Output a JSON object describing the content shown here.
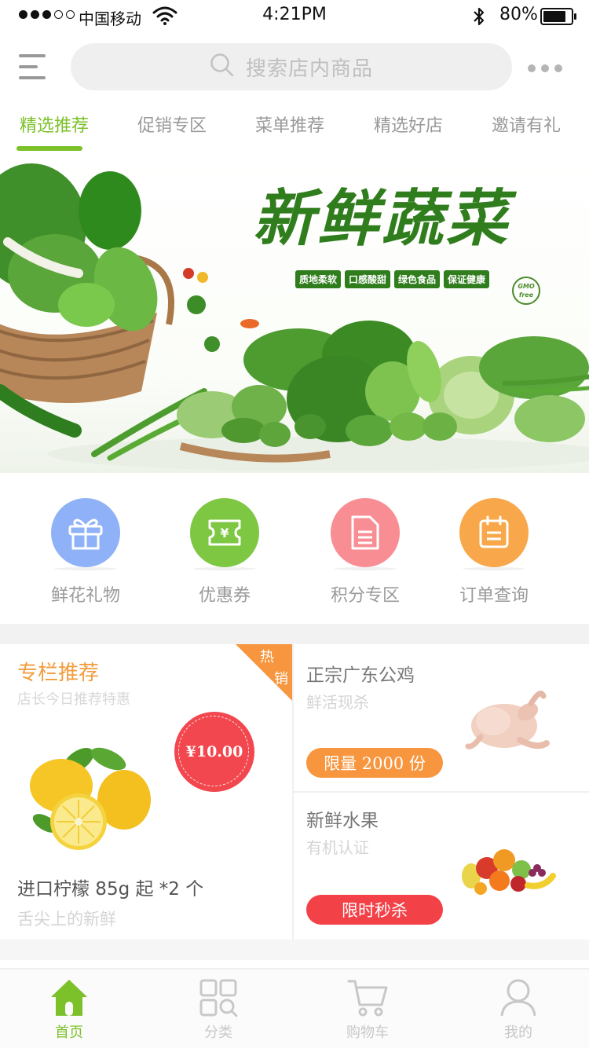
{
  "status_bar": {
    "carrier": "中国移动",
    "time": "4:21PM",
    "battery": "80%"
  },
  "header": {
    "menu_icon": "hamburger-icon",
    "search_placeholder": "搜索店内商品",
    "search_icon": "search-icon",
    "more_icon": "ellipsis-icon"
  },
  "tabs": [
    {
      "label": "精选推荐",
      "active": true
    },
    {
      "label": "促销专区",
      "active": false
    },
    {
      "label": "菜单推荐",
      "active": false
    },
    {
      "label": "精选好店",
      "active": false
    },
    {
      "label": "邀请有礼",
      "active": false
    }
  ],
  "banner": {
    "title": "新鲜蔬菜",
    "tags": [
      "质地柔软",
      "口感酸甜",
      "绿色食品",
      "保证健康"
    ],
    "logo_text": "GMO free"
  },
  "quick_entries": [
    {
      "label": "鲜花礼物",
      "icon": "gift-icon",
      "color": "#8fb1f7"
    },
    {
      "label": "优惠券",
      "icon": "coupon-icon",
      "color": "#7dc743"
    },
    {
      "label": "积分专区",
      "icon": "document-icon",
      "color": "#f88e94"
    },
    {
      "label": "订单查询",
      "icon": "calendar-icon",
      "color": "#f8a84a"
    }
  ],
  "featured": {
    "title": "专栏推荐",
    "subtitle": "店长今日推荐特惠",
    "hot_tag": [
      "热",
      "销"
    ],
    "price": "¥10.00",
    "product_name": "进口柠檬 85g 起 *2 个",
    "product_desc": "舌尖上的新鲜"
  },
  "cards": [
    {
      "title": "正宗广东公鸡",
      "subtitle": "鲜活现杀",
      "button": "限量 2000 份",
      "button_color": "#f7963e",
      "image": "chicken"
    },
    {
      "title": "新鲜水果",
      "subtitle": "有机认证",
      "button": "限时秒杀",
      "button_color": "#f34148",
      "image": "fruits"
    }
  ],
  "tabbar": [
    {
      "label": "首页",
      "icon": "home-icon",
      "active": true
    },
    {
      "label": "分类",
      "icon": "category-icon",
      "active": false
    },
    {
      "label": "购物车",
      "icon": "cart-icon",
      "active": false
    },
    {
      "label": "我的",
      "icon": "user-icon",
      "active": false
    }
  ],
  "colors": {
    "accent": "#7cc12a",
    "orange": "#f39c3c",
    "red": "#f2474e"
  }
}
